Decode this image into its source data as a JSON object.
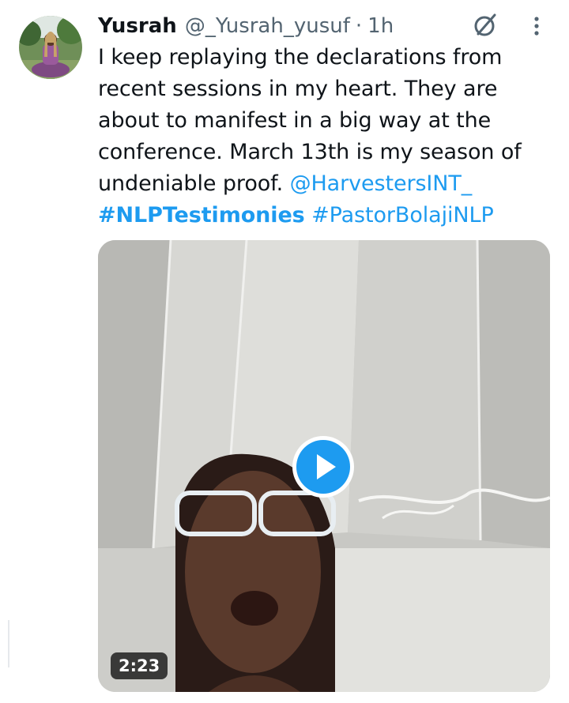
{
  "author": {
    "name": "Yusrah",
    "handle": "@_Yusrah_yusuf",
    "separator": "·",
    "time": "1h",
    "avatar_icon": "profile-photo"
  },
  "tweet": {
    "text": "I keep replaying the declarations from recent sessions in my heart. They are about to manifest in a big way at the conference. March 13th is my season of undeniable proof.",
    "mention": "@HarvestersINT_",
    "hashtags": [
      "#NLPTestimonies",
      "#PastorBolajiNLP"
    ]
  },
  "media": {
    "type": "video",
    "duration": "2:23",
    "play_icon": "play-icon"
  },
  "icons": {
    "grok": "grok-icon",
    "more": "more-options-icon"
  },
  "colors": {
    "link": "#1d9bf0",
    "secondary_text": "#536471",
    "primary_text": "#0f1419"
  }
}
